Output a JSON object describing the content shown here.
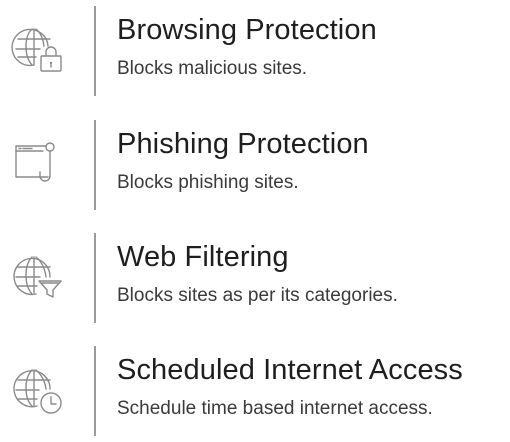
{
  "features": [
    {
      "title": "Browsing Protection",
      "description": "Blocks malicious sites.",
      "icon": "globe-lock-icon"
    },
    {
      "title": "Phishing Protection",
      "description": "Blocks phishing sites.",
      "icon": "browser-hook-icon"
    },
    {
      "title": "Web Filtering",
      "description": "Blocks sites as per its categories.",
      "icon": "globe-filter-icon"
    },
    {
      "title": "Scheduled Internet Access",
      "description": "Schedule time based internet access.",
      "icon": "globe-clock-icon"
    }
  ],
  "colors": {
    "icon_stroke": "#8a8a8a",
    "divider": "#9a9a9a",
    "title_text": "#1e1e1e",
    "description_text": "#3a3a3a"
  }
}
